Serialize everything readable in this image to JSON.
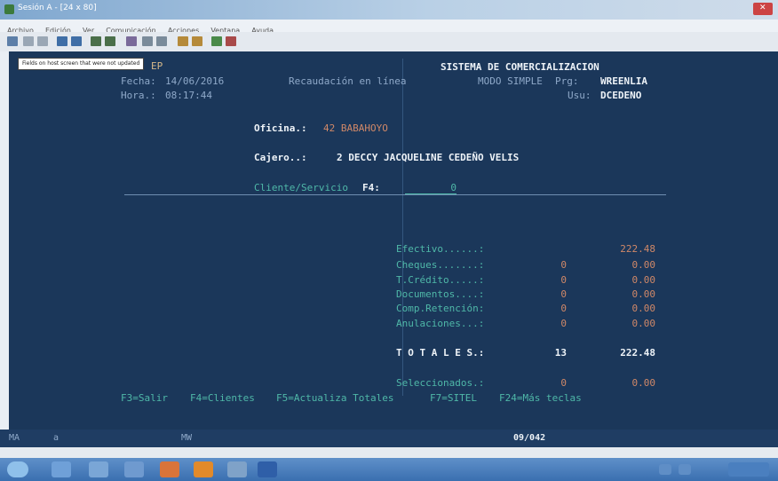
{
  "window": {
    "title": "Sesión A - [24 x 80]"
  },
  "menu": {
    "items": [
      "Archivo",
      "Edición",
      "Ver",
      "Comunicación",
      "Acciones",
      "Ventana",
      "Ayuda"
    ]
  },
  "tooltip": {
    "text": "Fields on host screen that were not updated"
  },
  "terminal": {
    "system_title": "SISTEMA DE COMERCIALIZACION",
    "ep": "EP",
    "fecha_label": "Fecha:",
    "fecha": "14/06/2016",
    "recaudacion": "Recaudación en línea",
    "mode": "MODO SIMPLE",
    "prg_label": "Prg:",
    "prg": "WREENLIA",
    "hora_label": "Hora.:",
    "hora": "08:17:44",
    "usu_label": "Usu:",
    "usu": "DCEDENO",
    "oficina_label": "Oficina.:",
    "oficina": "42 BABAHOYO",
    "cajero_label": "Cajero..:",
    "cajero": "2 DECCY JACQUELINE CEDEÑO VELIS",
    "cliente_label": "Cliente/Servicio",
    "f4_label": "F4:",
    "cliente_value": "0",
    "totals_rows": [
      {
        "label": "Efectivo......:",
        "count": "",
        "amount": "222.48"
      },
      {
        "label": "Cheques.......:",
        "count": "0",
        "amount": "0.00"
      },
      {
        "label": "T.Crédito.....:",
        "count": "0",
        "amount": "0.00"
      },
      {
        "label": "Documentos....:",
        "count": "0",
        "amount": "0.00"
      },
      {
        "label": "Comp.Retención:",
        "count": "0",
        "amount": "0.00"
      },
      {
        "label": "Anulaciones...:",
        "count": "0",
        "amount": "0.00"
      }
    ],
    "totales_label": "T O T A L E S.:",
    "totales_count": "13",
    "totales_amount": "222.48",
    "seleccionados_label": "Seleccionados.:",
    "seleccionados_count": "0",
    "seleccionados_amount": "0.00",
    "fkeys": [
      "F3=Salir",
      "F4=Clientes",
      "F5=Actualiza Totales",
      "F7=SITEL",
      "F24=Más teclas"
    ]
  },
  "status": {
    "mode": "MA",
    "session": "a",
    "mw": "MW",
    "cursor": "09/042"
  }
}
